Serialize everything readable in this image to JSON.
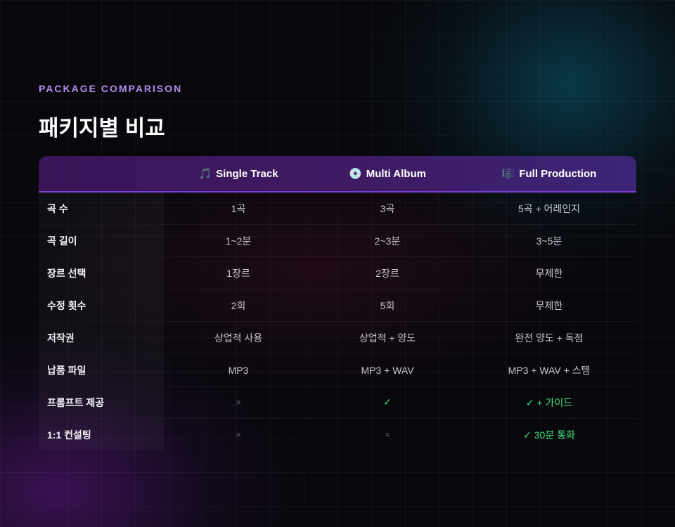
{
  "section": {
    "eyebrow": "PACKAGE COMPARISON",
    "title": "패키지별 비교"
  },
  "table": {
    "columns": [
      {
        "icon": "🎵",
        "icon_name": "music-note-icon",
        "label": "Single Track"
      },
      {
        "icon": "💿",
        "icon_name": "disc-icon",
        "label": "Multi Album"
      },
      {
        "icon": "🎼",
        "icon_name": "musical-score-icon",
        "label": "Full Production"
      }
    ],
    "rows": [
      {
        "label": "곡 수",
        "values": [
          "1곡",
          "3곡",
          "5곡 + 어레인지"
        ]
      },
      {
        "label": "곡 길이",
        "values": [
          "1~2분",
          "2~3분",
          "3~5분"
        ]
      },
      {
        "label": "장르 선택",
        "values": [
          "1장르",
          "2장르",
          "무제한"
        ]
      },
      {
        "label": "수정 횟수",
        "values": [
          "2회",
          "5회",
          "무제한"
        ]
      },
      {
        "label": "저작권",
        "values": [
          "상업적 사용",
          "상업적 + 양도",
          "완전 양도 + 독점"
        ]
      },
      {
        "label": "납품 파일",
        "values": [
          "MP3",
          "MP3 + WAV",
          "MP3 + WAV + 스템"
        ]
      },
      {
        "label": "프롬프트 제공",
        "values": [
          "×",
          "✓",
          "✓ + 가이드"
        ]
      },
      {
        "label": "1:1 컨설팅",
        "values": [
          "×",
          "×",
          "✓ 30분 통화"
        ]
      }
    ]
  },
  "colors": {
    "accent": "#b58cf0",
    "check": "#3ee07a",
    "cross": "#5b5a68",
    "header_start": "#3a1558",
    "header_end": "#3c2577"
  }
}
